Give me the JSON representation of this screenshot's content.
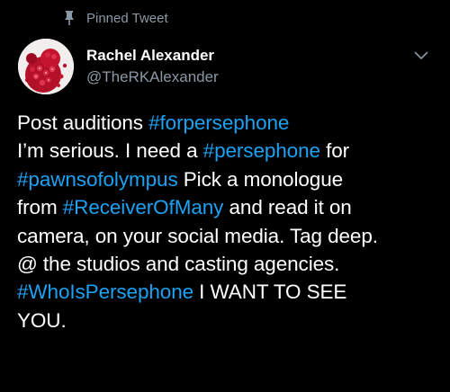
{
  "pinned": {
    "label": "Pinned Tweet",
    "icon": "pin-icon"
  },
  "author": {
    "name": "Rachel Alexander",
    "handle": "@TheRKAlexander",
    "avatar_icon": "pomegranate-avatar"
  },
  "menu": {
    "icon": "chevron-down-icon"
  },
  "colors": {
    "background": "#000000",
    "text": "#ffffff",
    "secondary": "#8b98a5",
    "hashtag": "#1da1f2"
  },
  "tweet": {
    "lines": [
      [
        {
          "text": "Post auditions ",
          "hashtag": false
        },
        {
          "text": "#forpersephone",
          "hashtag": true
        }
      ],
      [
        {
          "text": "I’m serious. I need a ",
          "hashtag": false
        },
        {
          "text": "#persephone",
          "hashtag": true
        },
        {
          "text": " for",
          "hashtag": false
        }
      ],
      [
        {
          "text": "#pawnsofolympus",
          "hashtag": true
        },
        {
          "text": " Pick a monologue",
          "hashtag": false
        }
      ],
      [
        {
          "text": "from ",
          "hashtag": false
        },
        {
          "text": "#ReceiverOfMany",
          "hashtag": true
        },
        {
          "text": " and read it on",
          "hashtag": false
        }
      ],
      [
        {
          "text": "camera, on your social media. Tag deep.",
          "hashtag": false
        }
      ],
      [
        {
          "text": "@ the studios and casting agencies.",
          "hashtag": false
        }
      ],
      [
        {
          "text": "#WhoIsPersephone",
          "hashtag": true
        },
        {
          "text": " I WANT TO SEE",
          "hashtag": false
        }
      ],
      [
        {
          "text": "YOU.",
          "hashtag": false
        }
      ]
    ]
  }
}
